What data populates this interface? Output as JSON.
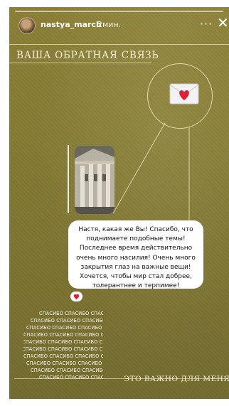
{
  "header": {
    "username": "nastya_march",
    "time": "2мин.",
    "more_icon": "···",
    "close_icon": "✕"
  },
  "story": {
    "heading": "ВАША ОБРАТНАЯ СВЯЗЬ",
    "message": "Настя, какая же Вы! Спасибо, что поднимаете подобные темы! Последнее время действительно очень много насилия! Очень много закрытия глаз на важные вещи! Хочется, чтобы мир стал добрее, толерантнее и терпимее!",
    "reaction": "❤",
    "pattern_text": "СПАСИБО СПАСИБО СПАСИБО СПАСИБО",
    "footer": "ЭТО ВАЖНО ДЛЯ МЕНЯ"
  },
  "icons": {
    "envelope": "envelope-heart-icon",
    "reaction": "heart-icon"
  },
  "colors": {
    "background": "#847a33",
    "heart": "#e0203a",
    "text_light": "#f4efd8"
  }
}
